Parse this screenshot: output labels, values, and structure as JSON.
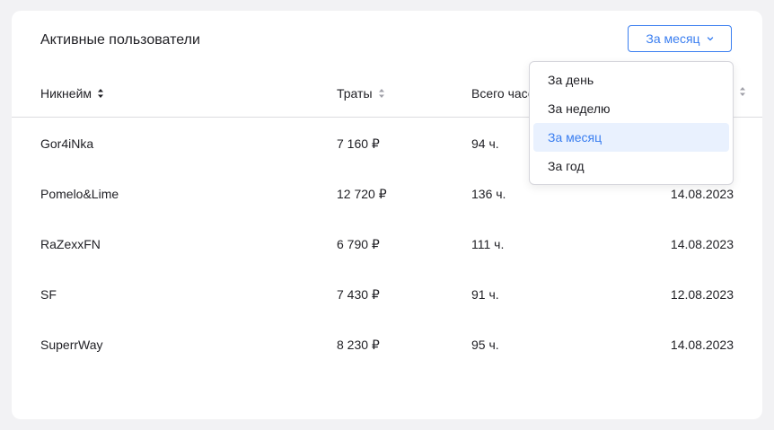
{
  "widget": {
    "title": "Активные пользователи",
    "period_selected": "За месяц"
  },
  "table": {
    "headers": {
      "nickname": "Никнейм",
      "spending": "Траты",
      "hours": "Всего часов"
    },
    "rows": [
      {
        "nickname": "Gor4iNka",
        "spending": "7 160 ₽",
        "hours": "94 ч.",
        "date": ""
      },
      {
        "nickname": "Pomelo&Lime",
        "spending": "12 720 ₽",
        "hours": "136 ч.",
        "date": "14.08.2023"
      },
      {
        "nickname": "RaZexxFN",
        "spending": "6 790 ₽",
        "hours": "111 ч.",
        "date": "14.08.2023"
      },
      {
        "nickname": "SF",
        "spending": "7 430 ₽",
        "hours": "91 ч.",
        "date": "12.08.2023"
      },
      {
        "nickname": "SuperrWay",
        "spending": "8 230 ₽",
        "hours": "95 ч.",
        "date": "14.08.2023"
      }
    ]
  },
  "dropdown": {
    "options": [
      "За день",
      "За неделю",
      "За месяц",
      "За год"
    ],
    "selected_index": 2
  },
  "colors": {
    "accent": "#3a7ef0",
    "selected_bg": "#e9f1fe",
    "page_bg": "#f2f2f4",
    "card_bg": "#ffffff"
  }
}
